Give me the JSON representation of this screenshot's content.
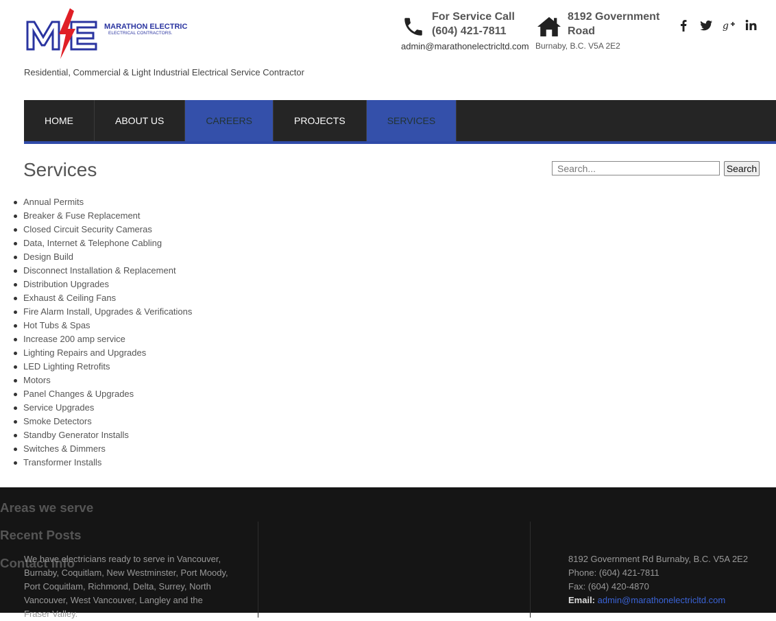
{
  "brand": {
    "logo_letters": "ME",
    "logo_name": "MARATHON ELECTRIC LTD.",
    "logo_sub": "ELECTRICAL CONTRACTORS.",
    "tagline": "Residential, Commercial & Light Industrial Electrical Service Contractor",
    "colors": {
      "blue": "#2a34a0",
      "red": "#e01f26"
    }
  },
  "header": {
    "phone_title": "For Service Call",
    "phone_number": "(604) 421-7811",
    "email": "admin@marathonelectricltd.com",
    "address_line1": "8192 Government",
    "address_line2": "Road",
    "city": "Burnaby, B.C. V5A 2E2",
    "social_icons": [
      "facebook-icon",
      "twitter-icon",
      "google-plus-icon",
      "linkedin-icon"
    ]
  },
  "nav": {
    "items": [
      {
        "label": "HOME",
        "active": false
      },
      {
        "label": "ABOUT US",
        "active": false
      },
      {
        "label": "CAREERS",
        "active": true
      },
      {
        "label": "PROJECTS",
        "active": false
      },
      {
        "label": "SERVICES",
        "active": true
      }
    ],
    "accent": "#3450aa"
  },
  "main": {
    "title": "Services",
    "search_placeholder": "Search...",
    "search_button": "Search",
    "services": [
      "Annual Permits",
      "Breaker & Fuse Replacement",
      "Closed Circuit Security Cameras",
      "Data, Internet & Telephone Cabling",
      "Design Build",
      "Disconnect Installation & Replacement",
      "Distribution Upgrades",
      "Exhaust & Ceiling Fans",
      "Fire Alarm Install, Upgrades & Verifications",
      "Hot Tubs & Spas",
      "Increase 200 amp service",
      "Lighting Repairs and Upgrades",
      "LED Lighting Retrofits",
      "Motors",
      "Panel Changes & Upgrades",
      "Service Upgrades",
      "Smoke Detectors",
      "Standby Generator Installs",
      "Switches & Dimmers",
      "Transformer Installs"
    ]
  },
  "footer": {
    "areas_title": "Areas we serve",
    "areas_text": "We have electricians ready to serve in Vancouver, Burnaby, Coquitlam, New Westminster, Port Moody, Port Coquitlam, Richmond, Delta, Surrey, North Vancouver, West Vancouver, Langley and the Fraser Valley.",
    "posts_title": "Recent Posts",
    "contact_title": "Contact Info",
    "contact_address": "8192 Government Rd Burnaby, B.C. V5A 2E2",
    "contact_phone": "Phone: (604) 421-7811",
    "contact_fax": "Fax: (604) 420-4870",
    "contact_email_label": "Email:",
    "contact_email": "admin@marathonelectricltd.com"
  }
}
